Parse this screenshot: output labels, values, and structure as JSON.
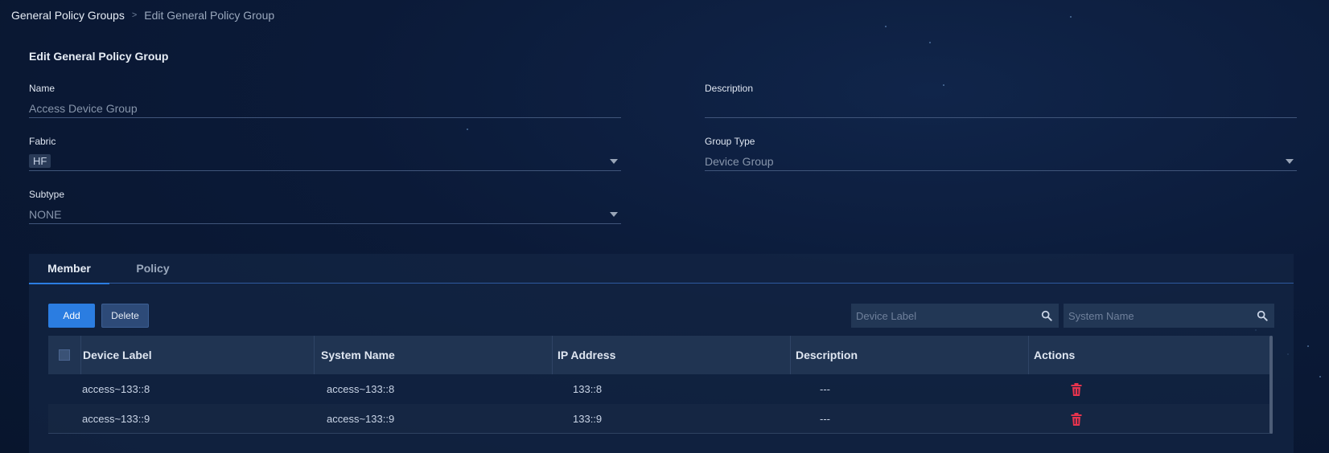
{
  "breadcrumb": {
    "root": "General Policy Groups",
    "separator": ">",
    "current": "Edit General Policy Group"
  },
  "page": {
    "title": "Edit General Policy Group"
  },
  "form": {
    "name": {
      "label": "Name",
      "value": "Access Device Group"
    },
    "description": {
      "label": "Description",
      "value": ""
    },
    "fabric": {
      "label": "Fabric",
      "value": "HF"
    },
    "group_type": {
      "label": "Group Type",
      "value": "Device Group"
    },
    "subtype": {
      "label": "Subtype",
      "value": "NONE"
    }
  },
  "tabs": [
    {
      "label": "Member",
      "active": true
    },
    {
      "label": "Policy",
      "active": false
    }
  ],
  "toolbar": {
    "add_label": "Add",
    "delete_label": "Delete",
    "search_device_label_placeholder": "Device Label",
    "search_system_name_placeholder": "System Name"
  },
  "table": {
    "columns": [
      "Device Label",
      "System Name",
      "IP Address",
      "Description",
      "Actions"
    ],
    "rows": [
      {
        "device_label": "access~133::8",
        "system_name": "access~133::8",
        "ip_address": "133::8",
        "description": "---"
      },
      {
        "device_label": "access~133::9",
        "system_name": "access~133::9",
        "ip_address": "133::9",
        "description": "---"
      }
    ]
  },
  "colors": {
    "accent": "#2b7de1",
    "delete_icon": "#e8344e",
    "background": "#0b1a38"
  },
  "icons": {
    "search": "search-icon",
    "dropdown": "chevron-down-icon",
    "delete_row": "trash-icon"
  }
}
